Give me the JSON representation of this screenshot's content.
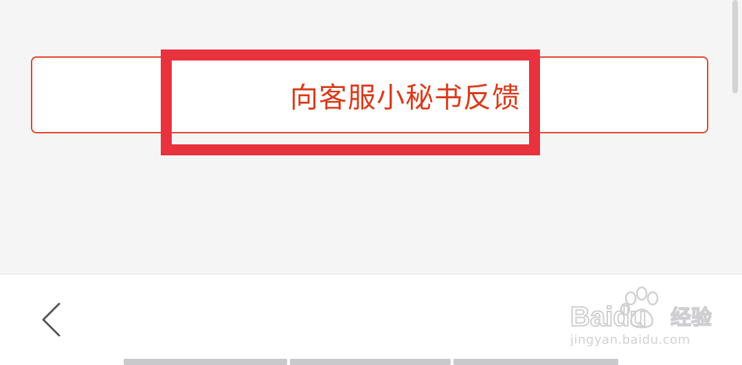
{
  "feedback_button": {
    "label": "向客服小秘书反馈"
  },
  "colors": {
    "accent": "#e0462a",
    "label_text": "#d93c1c",
    "highlight": "#e8323d",
    "page_bg": "#f5f5f6",
    "bar_bg": "#ffffff"
  },
  "icons": {
    "back": "chevron-left-icon",
    "watermark_logo": "baidu-paw-icon"
  },
  "watermark": {
    "brand": "Baidu",
    "suffix": "经验",
    "site": "jingyan.baidu.com"
  }
}
